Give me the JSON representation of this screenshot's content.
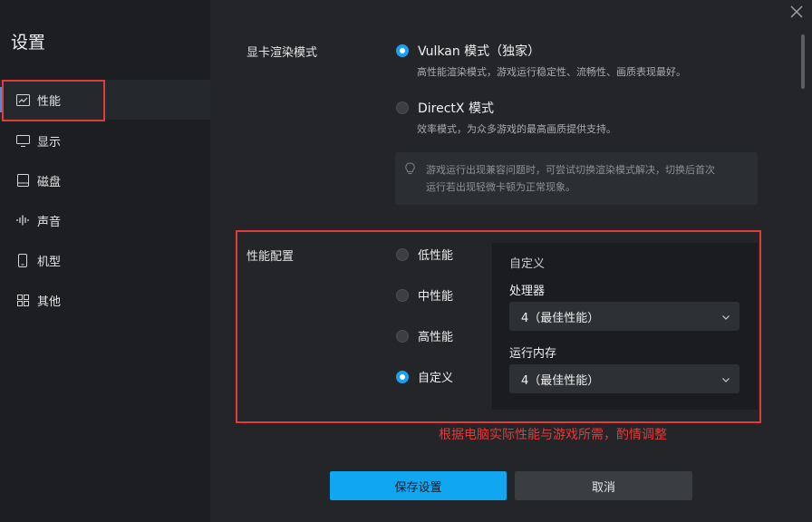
{
  "sidebar": {
    "title": "设置",
    "items": [
      {
        "label": "性能",
        "icon": "chart-line-icon"
      },
      {
        "label": "显示",
        "icon": "monitor-icon"
      },
      {
        "label": "磁盘",
        "icon": "disk-icon"
      },
      {
        "label": "声音",
        "icon": "sound-wave-icon"
      },
      {
        "label": "机型",
        "icon": "phone-icon"
      },
      {
        "label": "其他",
        "icon": "grid-icon"
      }
    ],
    "active_index": 0
  },
  "render_mode": {
    "label": "显卡渲染模式",
    "options": [
      {
        "label": "Vulkan 模式（独家）",
        "desc": "高性能渲染模式，游戏运行稳定性、流畅性、画质表现最好。",
        "selected": true
      },
      {
        "label": "DirectX 模式",
        "desc": "效率模式，为众多游戏的最高画质提供支持。",
        "selected": false
      }
    ],
    "tip_line1": "游戏运行出现兼容问题时，可尝试切换渲染模式解决，切换后首次",
    "tip_line2": "运行若出现轻微卡顿为正常现象。"
  },
  "performance": {
    "label": "性能配置",
    "options": [
      {
        "label": "低性能",
        "selected": false
      },
      {
        "label": "中性能",
        "selected": false
      },
      {
        "label": "高性能",
        "selected": false
      },
      {
        "label": "自定义",
        "selected": true
      }
    ],
    "custom": {
      "title": "自定义",
      "cpu_label": "处理器",
      "cpu_value": "4（最佳性能）",
      "ram_label": "运行内存",
      "ram_value": "4（最佳性能）"
    }
  },
  "annotation_note": "根据电脑实际性能与游戏所需，酌情调整",
  "buttons": {
    "save": "保存设置",
    "cancel": "取消"
  },
  "colors": {
    "accent": "#10a7f0",
    "highlight": "#e23b3b",
    "bg": "#232529",
    "sidebar_bg": "#1c1e22"
  }
}
